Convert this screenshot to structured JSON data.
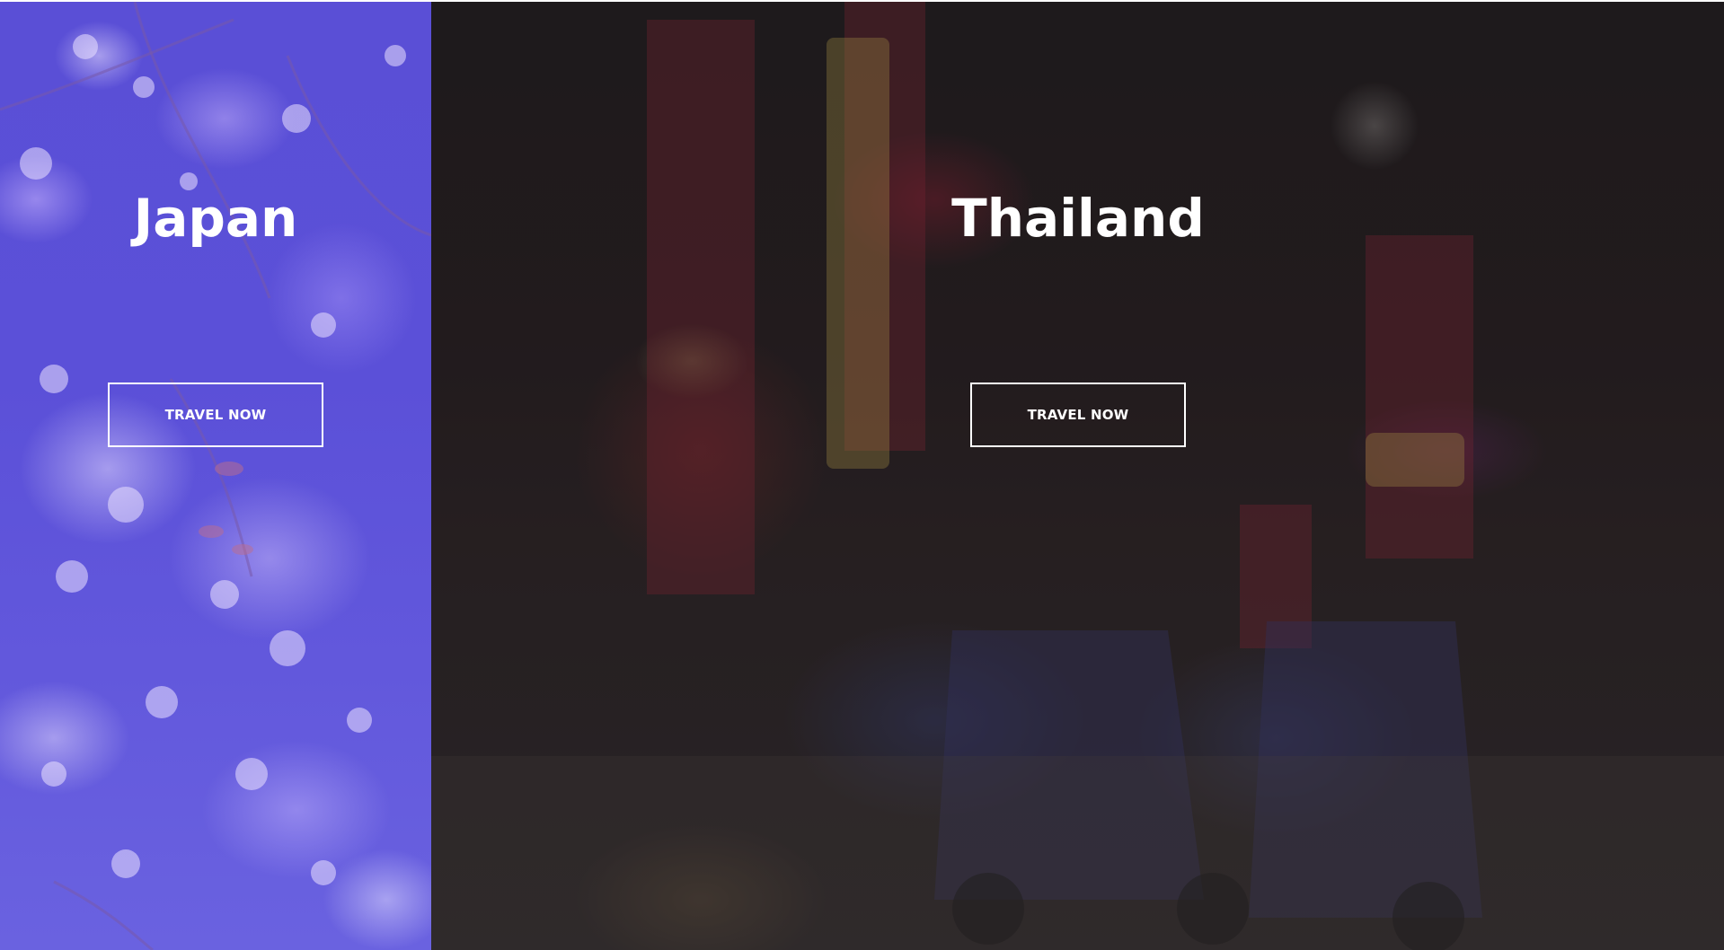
{
  "panels": [
    {
      "id": "japan",
      "title": "Japan",
      "button_label": "TRAVEL NOW",
      "tint_color": "#5a4fd6"
    },
    {
      "id": "thailand",
      "title": "Thailand",
      "button_label": "TRAVEL NOW",
      "tint_color": "#1f1b1c"
    }
  ]
}
